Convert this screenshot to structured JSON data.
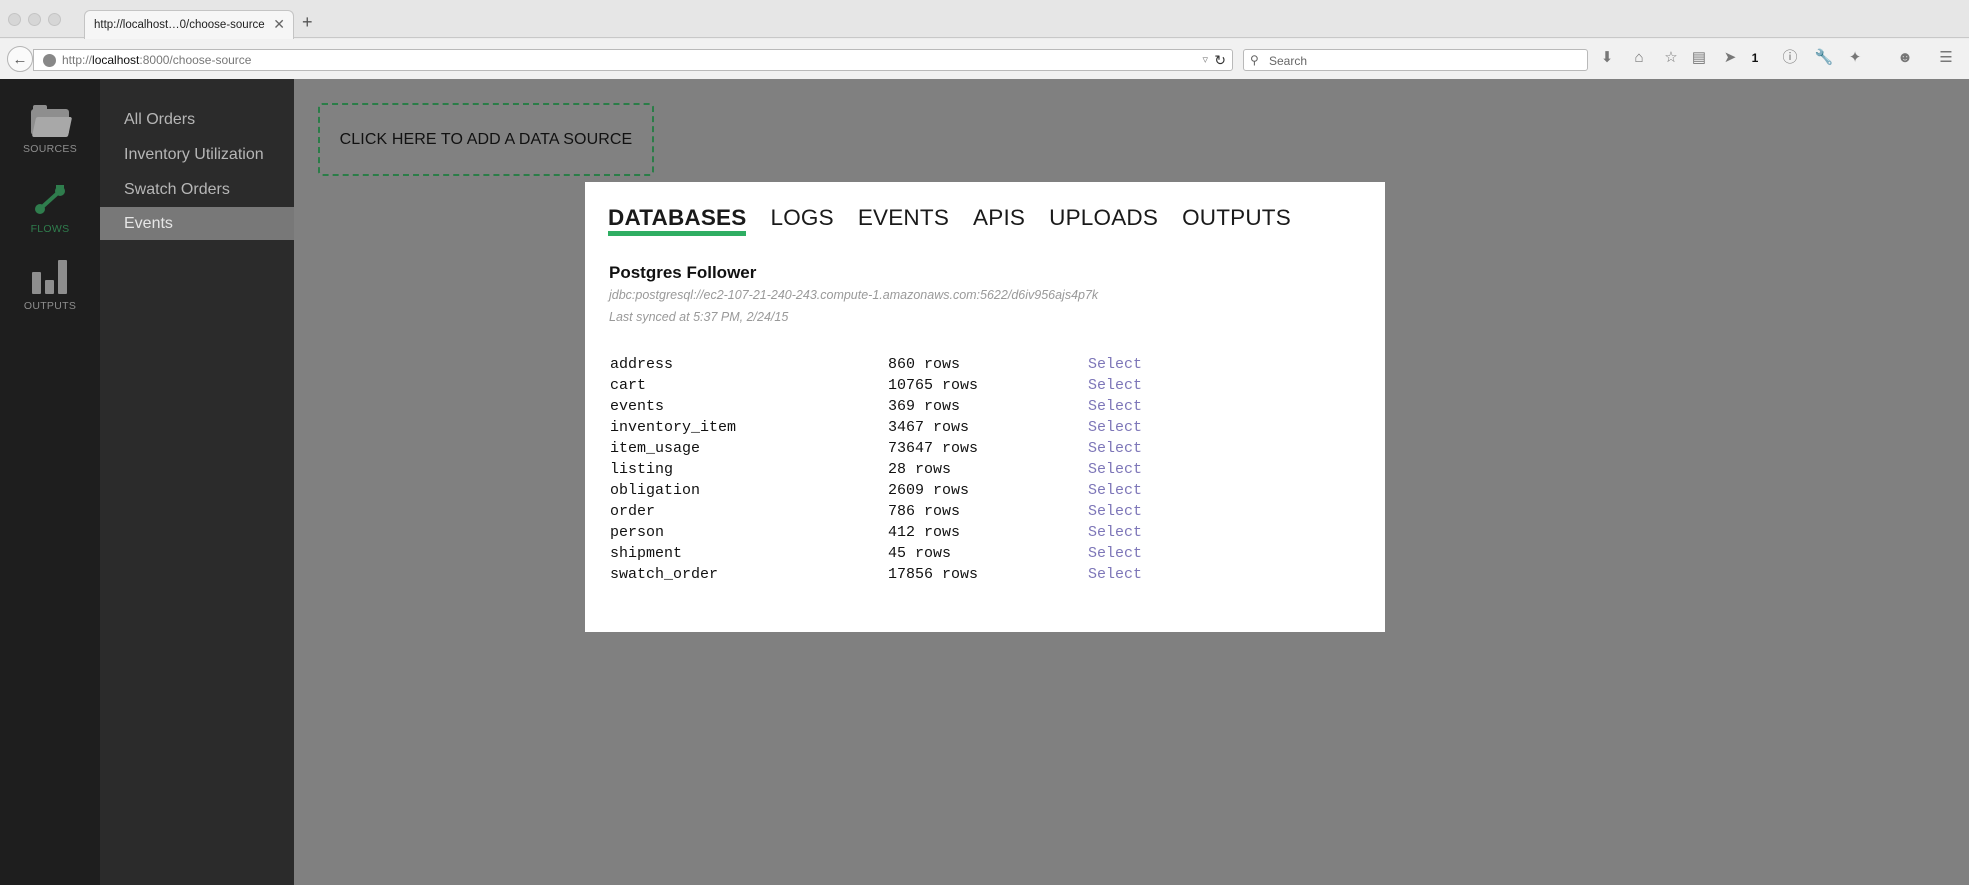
{
  "browser": {
    "tab_title": "http://localhost…0/choose-source",
    "url_host_prefix": "http://",
    "url_host": "localhost",
    "url_rest": ":8000/choose-source",
    "search_placeholder": "Search",
    "tab_close_glyph": "✕",
    "new_tab_glyph": "+",
    "icons": [
      "back-icon",
      "globe-icon",
      "reload-icon",
      "search-icon",
      "download-icon",
      "home-icon",
      "bookmark-star-icon",
      "reader-icon",
      "send-icon",
      "tab-counter-icon",
      "info-icon",
      "wrench-icon",
      "extension-icon",
      "emoji-icon",
      "menu-icon"
    ],
    "tab_counter": "1"
  },
  "rail": {
    "items": [
      {
        "label": "SOURCES",
        "icon": "folder-icon",
        "active": false
      },
      {
        "label": "FLOWS",
        "icon": "flows-icon",
        "active": true
      },
      {
        "label": "OUTPUTS",
        "icon": "bar-chart-icon",
        "active": false
      }
    ]
  },
  "sidenav": {
    "items": [
      {
        "label": "All Orders",
        "active": false
      },
      {
        "label": "Inventory Utilization",
        "active": false
      },
      {
        "label": "Swatch Orders",
        "active": false
      },
      {
        "label": "Events",
        "active": true
      }
    ]
  },
  "main": {
    "add_source_label": "CLICK HERE TO ADD A DATA SOURCE"
  },
  "modal": {
    "tabs": [
      {
        "label": "DATABASES",
        "active": true
      },
      {
        "label": "LOGS",
        "active": false
      },
      {
        "label": "EVENTS",
        "active": false
      },
      {
        "label": "APIS",
        "active": false
      },
      {
        "label": "UPLOADS",
        "active": false
      },
      {
        "label": "OUTPUTS",
        "active": false
      }
    ],
    "db_name": "Postgres Follower",
    "db_url": "jdbc:postgresql://ec2-107-21-240-243.compute-1.amazonaws.com:5622/d6iv956ajs4p7k",
    "last_synced": "Last synced at 5:37 PM, 2/24/15",
    "select_label": "Select",
    "tables": [
      {
        "name": "address",
        "rows": "860 rows"
      },
      {
        "name": "cart",
        "rows": "10765 rows"
      },
      {
        "name": "events",
        "rows": "369 rows"
      },
      {
        "name": "inventory_item",
        "rows": "3467 rows"
      },
      {
        "name": "item_usage",
        "rows": "73647 rows"
      },
      {
        "name": "listing",
        "rows": "28 rows"
      },
      {
        "name": "obligation",
        "rows": "2609 rows"
      },
      {
        "name": "order",
        "rows": "786 rows"
      },
      {
        "name": "person",
        "rows": "412 rows"
      },
      {
        "name": "shipment",
        "rows": "45 rows"
      },
      {
        "name": "swatch_order",
        "rows": "17856 rows"
      }
    ]
  },
  "colors": {
    "accent_green": "#2fae63",
    "dashed_border": "#2b7d48",
    "select_link": "#7d76b8"
  }
}
